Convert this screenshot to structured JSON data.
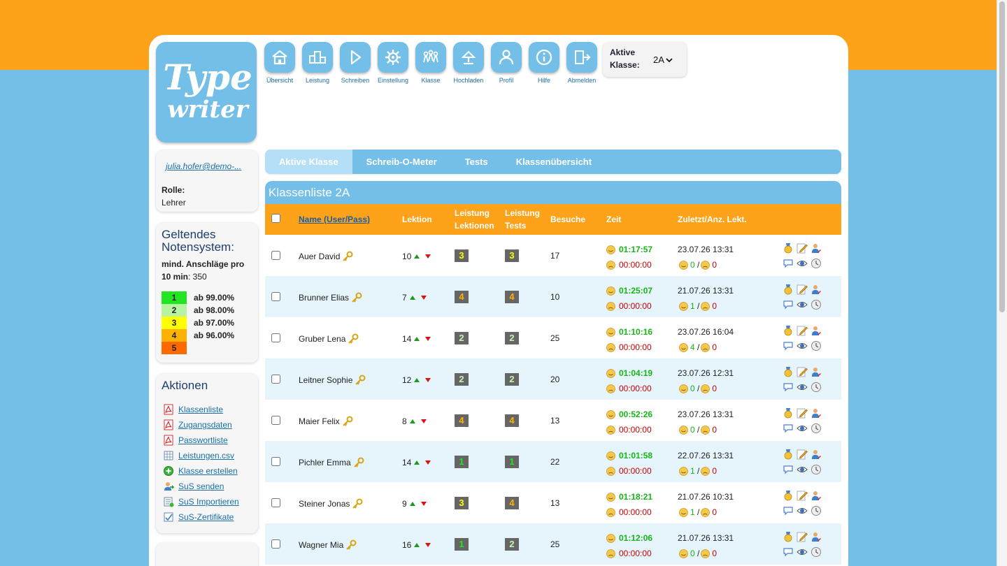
{
  "nav": {
    "items": [
      {
        "label": "Übersicht",
        "icon": "home-icon"
      },
      {
        "label": "Leistung",
        "icon": "podium-icon"
      },
      {
        "label": "Schreiben",
        "icon": "play-icon"
      },
      {
        "label": "Einstellung",
        "icon": "gear-icon"
      },
      {
        "label": "Klasse",
        "icon": "group-icon"
      },
      {
        "label": "Hochladen",
        "icon": "upload-icon"
      },
      {
        "label": "Profil",
        "icon": "person-icon"
      },
      {
        "label": "Hilfe",
        "icon": "info-icon"
      },
      {
        "label": "Abmelden",
        "icon": "logout-icon"
      }
    ]
  },
  "logo": {
    "line1": "Type",
    "line2": "writer"
  },
  "klasse": {
    "label": "Aktive Klasse:",
    "selected": "2A"
  },
  "user": {
    "email": "julia.hofer@demo-...",
    "rolle_label": "Rolle:",
    "rolle": "Lehrer"
  },
  "noten": {
    "title": "Geltendes Notensystem:",
    "desc_bold": "mind. Anschläge pro 10 min",
    "desc_value": ": 350",
    "grades": [
      {
        "grade": "1",
        "pct": "ab 99.00%",
        "color": "#22e522"
      },
      {
        "grade": "2",
        "pct": "ab 98.00%",
        "color": "#b7f3a0"
      },
      {
        "grade": "3",
        "pct": "ab 97.00%",
        "color": "#ffff00"
      },
      {
        "grade": "4",
        "pct": "ab 96.00%",
        "color": "#ffb300"
      },
      {
        "grade": "5",
        "pct": "",
        "color": "#ff6a00"
      }
    ]
  },
  "aktionen": {
    "title": "Aktionen",
    "items": [
      {
        "label": "Klassenliste",
        "icon": "pdf-icon"
      },
      {
        "label": "Zugangsdaten",
        "icon": "pdf-icon"
      },
      {
        "label": "Passwortliste",
        "icon": "pdf-icon"
      },
      {
        "label": "Leistungen.csv",
        "icon": "csv-icon"
      },
      {
        "label": "Klasse erstellen",
        "icon": "add-icon"
      },
      {
        "label": "SuS senden",
        "icon": "send-users-icon"
      },
      {
        "label": "SuS Importieren",
        "icon": "import-icon"
      },
      {
        "label": "SuS-Zertifikate",
        "icon": "certificate-icon"
      }
    ]
  },
  "tabs": [
    "Aktive Klasse",
    "Schreib-O-Meter",
    "Tests",
    "Klassenübersicht"
  ],
  "list_title": "Klassenliste 2A",
  "table": {
    "headers": {
      "name": "Name (User/Pass)",
      "lektion": "Lektion",
      "leistung_lektionen": "Leistung Lektionen",
      "leistung_tests": "Leistung Tests",
      "besuche": "Besuche",
      "zeit": "Zeit",
      "zuletzt": "Zuletzt/Anz. Lekt."
    },
    "rows": [
      {
        "name": "Auer David",
        "lektion": "10",
        "ll": "3",
        "lt": "3",
        "besuche": "17",
        "zeit_good": "01:17:57",
        "zeit_bad": "00:00:00",
        "zuletzt": "23.07.26 13:31",
        "good": "0",
        "bad": "0"
      },
      {
        "name": "Brunner Elias",
        "lektion": "7",
        "ll": "4",
        "lt": "4",
        "besuche": "10",
        "zeit_good": "01:25:07",
        "zeit_bad": "00:00:00",
        "zuletzt": "21.07.26 13:31",
        "good": "1",
        "bad": "0"
      },
      {
        "name": "Gruber Lena",
        "lektion": "14",
        "ll": "2",
        "lt": "2",
        "besuche": "25",
        "zeit_good": "01:10:16",
        "zeit_bad": "00:00:00",
        "zuletzt": "23.07.26 16:04",
        "good": "4",
        "bad": "0"
      },
      {
        "name": "Leitner Sophie",
        "lektion": "12",
        "ll": "2",
        "lt": "2",
        "besuche": "20",
        "zeit_good": "01:04:19",
        "zeit_bad": "00:00:00",
        "zuletzt": "23.07.26 12:31",
        "good": "0",
        "bad": "0"
      },
      {
        "name": "Maier Felix",
        "lektion": "8",
        "ll": "4",
        "lt": "4",
        "besuche": "13",
        "zeit_good": "00:52:26",
        "zeit_bad": "00:00:00",
        "zuletzt": "23.07.26 13:31",
        "good": "0",
        "bad": "0"
      },
      {
        "name": "Pichler Emma",
        "lektion": "14",
        "ll": "1",
        "lt": "1",
        "besuche": "22",
        "zeit_good": "01:01:58",
        "zeit_bad": "00:00:00",
        "zuletzt": "22.07.26 13:31",
        "good": "1",
        "bad": "0"
      },
      {
        "name": "Steiner Jonas",
        "lektion": "9",
        "ll": "3",
        "lt": "4",
        "besuche": "13",
        "zeit_good": "01:18:21",
        "zeit_bad": "00:00:00",
        "zuletzt": "21.07.26 10:31",
        "good": "1",
        "bad": "0"
      },
      {
        "name": "Wagner Mia",
        "lektion": "16",
        "ll": "1",
        "lt": "2",
        "besuche": "25",
        "zeit_good": "01:12:06",
        "zeit_bad": "00:00:00",
        "zuletzt": "21.07.26 13:31",
        "good": "0",
        "bad": "0"
      }
    ]
  },
  "colors": {
    "orange": "#fea21a",
    "blue": "#74bfe8",
    "green_time": "#17b617",
    "red_time": "#cc0000"
  }
}
